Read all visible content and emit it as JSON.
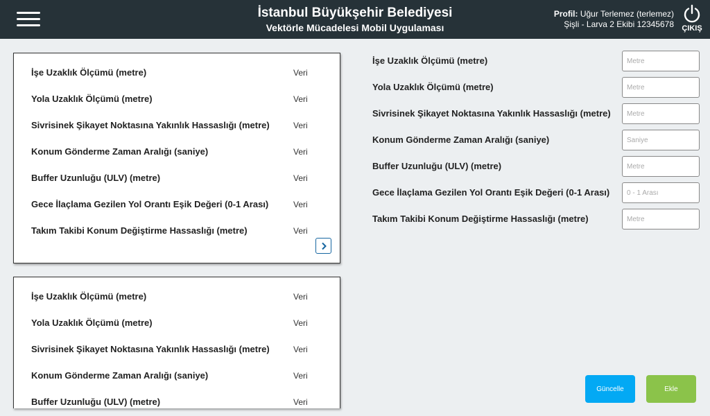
{
  "header": {
    "title": "İstanbul Büyükşehir Belediyesi",
    "subtitle": "Vektörle Mücadelesi Mobil Uygulaması",
    "profile_label": "Profil:",
    "profile_name": "Uğur Terlemez (terlemez)",
    "profile_detail": "Şişli - Larva 2 Ekibi 12345678",
    "logout_label": "ÇIKIŞ"
  },
  "list_card_1": {
    "rows": [
      {
        "label": "İşe Uzaklık Ölçümü (metre)",
        "value": "Veri"
      },
      {
        "label": "Yola Uzaklık Ölçümü (metre)",
        "value": "Veri"
      },
      {
        "label": "Sivrisinek Şikayet Noktasına Yakınlık Hassaslığı (metre)",
        "value": "Veri"
      },
      {
        "label": "Konum Gönderme Zaman Aralığı (saniye)",
        "value": "Veri"
      },
      {
        "label": "Buffer Uzunluğu (ULV) (metre)",
        "value": "Veri"
      },
      {
        "label": "Gece İlaçlama Gezilen Yol Orantı Eşik Değeri (0-1 Arası)",
        "value": "Veri"
      },
      {
        "label": "Takım Takibi Konum Değiştirme Hassaslığı (metre)",
        "value": "Veri"
      }
    ]
  },
  "list_card_2": {
    "rows": [
      {
        "label": "İşe Uzaklık Ölçümü (metre)",
        "value": "Veri"
      },
      {
        "label": "Yola Uzaklık Ölçümü (metre)",
        "value": "Veri"
      },
      {
        "label": "Sivrisinek Şikayet Noktasına Yakınlık Hassaslığı (metre)",
        "value": "Veri"
      },
      {
        "label": "Konum Gönderme Zaman Aralığı (saniye)",
        "value": "Veri"
      },
      {
        "label": "Buffer Uzunluğu (ULV) (metre)",
        "value": "Veri"
      }
    ]
  },
  "form": {
    "fields": [
      {
        "label": "İşe Uzaklık Ölçümü (metre)",
        "placeholder": "Metre",
        "value": ""
      },
      {
        "label": "Yola Uzaklık Ölçümü (metre)",
        "placeholder": "Metre",
        "value": ""
      },
      {
        "label": "Sivrisinek Şikayet Noktasına Yakınlık Hassaslığı (metre)",
        "placeholder": "Metre",
        "value": ""
      },
      {
        "label": "Konum Gönderme Zaman Aralığı (saniye)",
        "placeholder": "Saniye",
        "value": ""
      },
      {
        "label": "Buffer Uzunluğu (ULV) (metre)",
        "placeholder": "Metre",
        "value": ""
      },
      {
        "label": "Gece İlaçlama Gezilen Yol Orantı Eşik Değeri (0-1 Arası)",
        "placeholder": "0 - 1 Arası",
        "value": ""
      },
      {
        "label": "Takım Takibi Konum Değiştirme Hassaslığı (metre)",
        "placeholder": "Metre",
        "value": ""
      }
    ],
    "update_button": "Güncelle",
    "add_button": "Ekle"
  },
  "icons": {
    "menu": "hamburger-menu-icon",
    "logout": "power-icon",
    "next": "chevron-right-icon"
  },
  "colors": {
    "header_bg": "#263238",
    "page_bg": "#eceff1",
    "update_button": "#03a9f4",
    "add_button": "#8bc34a",
    "next_button_border": "#1565a0"
  }
}
